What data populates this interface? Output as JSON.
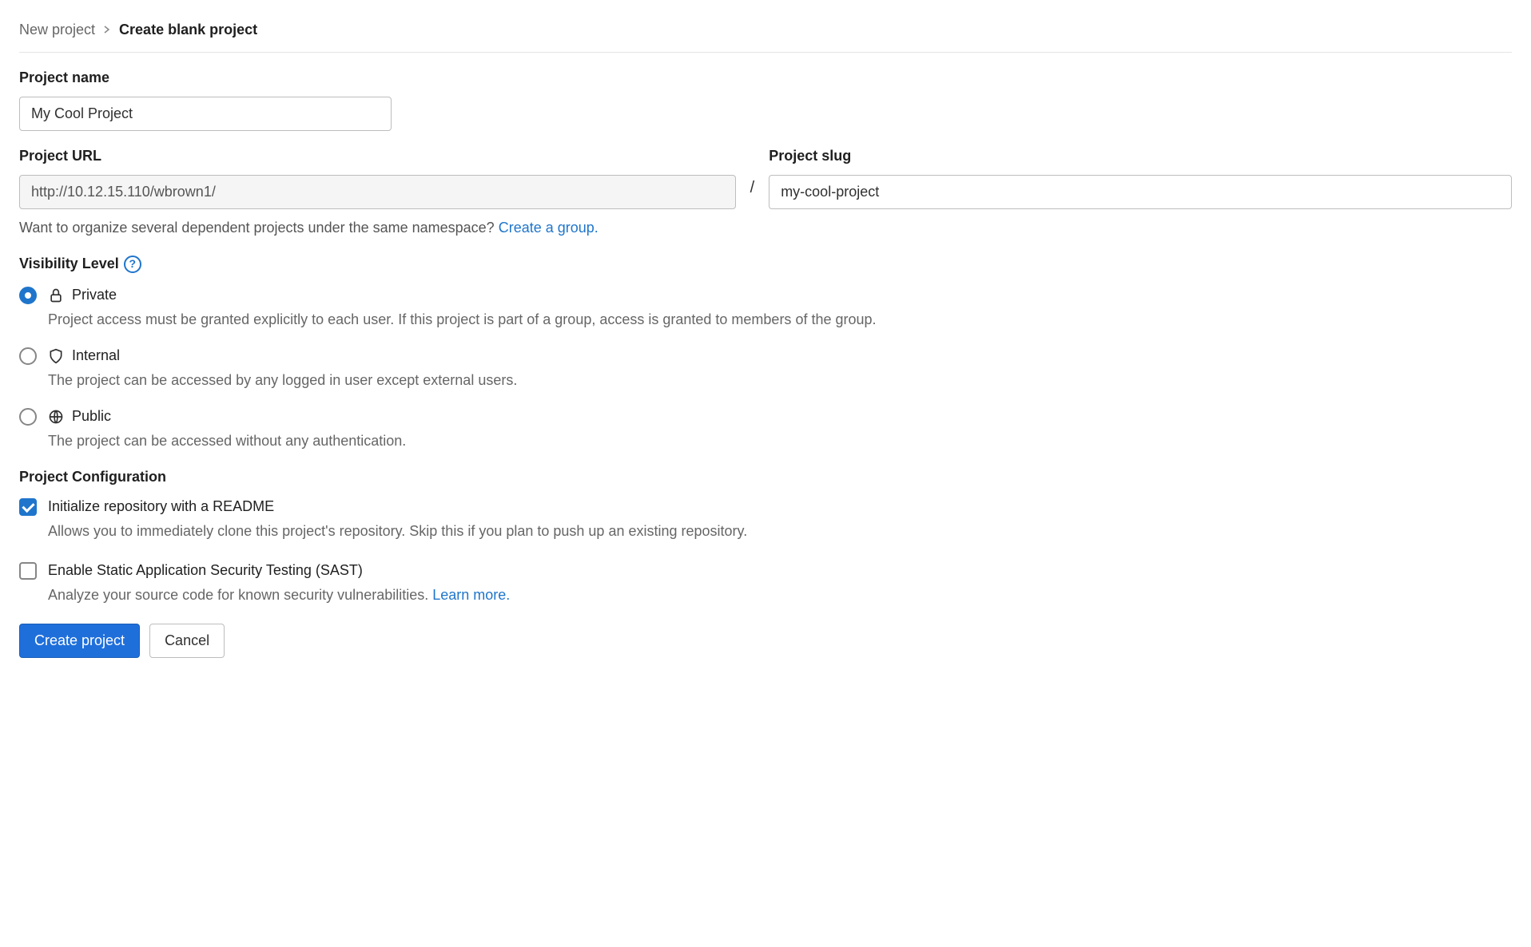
{
  "breadcrumb": {
    "parent": "New project",
    "current": "Create blank project"
  },
  "project_name": {
    "label": "Project name",
    "value": "My Cool Project"
  },
  "project_url": {
    "label": "Project URL",
    "value": "http://10.12.15.110/wbrown1/",
    "separator": "/"
  },
  "project_slug": {
    "label": "Project slug",
    "value": "my-cool-project"
  },
  "namespace_hint": {
    "text": "Want to organize several dependent projects under the same namespace?",
    "link": "Create a group."
  },
  "visibility": {
    "label": "Visibility Level",
    "options": [
      {
        "key": "private",
        "title": "Private",
        "desc": "Project access must be granted explicitly to each user. If this project is part of a group, access is granted to members of the group.",
        "checked": true
      },
      {
        "key": "internal",
        "title": "Internal",
        "desc": "The project can be accessed by any logged in user except external users.",
        "checked": false
      },
      {
        "key": "public",
        "title": "Public",
        "desc": "The project can be accessed without any authentication.",
        "checked": false
      }
    ]
  },
  "config": {
    "label": "Project Configuration",
    "readme": {
      "title": "Initialize repository with a README",
      "desc": "Allows you to immediately clone this project's repository. Skip this if you plan to push up an existing repository.",
      "checked": true
    },
    "sast": {
      "title": "Enable Static Application Security Testing (SAST)",
      "desc": "Analyze your source code for known security vulnerabilities.",
      "link": "Learn more.",
      "checked": false
    }
  },
  "actions": {
    "submit": "Create project",
    "cancel": "Cancel"
  }
}
